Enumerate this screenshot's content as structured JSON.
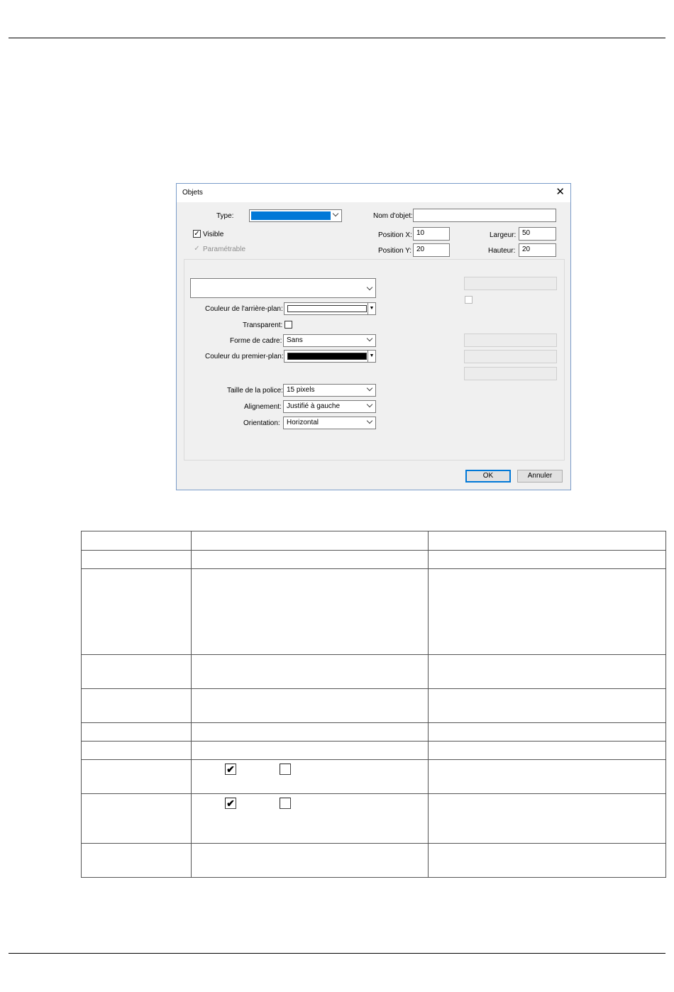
{
  "dialog": {
    "title": "Objets",
    "type_label": "Type:",
    "type_swatch_color": "#0078d7",
    "nom_label": "Nom d'objet:",
    "nom_value": "",
    "visible_label": "Visible",
    "visible_checked": true,
    "parametrable_label": "Paramétrable",
    "parametrable_checked": true,
    "posx_label": "Position X:",
    "posx_value": "10",
    "posy_label": "Position Y:",
    "posy_value": "20",
    "largeur_label": "Largeur:",
    "largeur_value": "50",
    "hauteur_label": "Hauteur:",
    "hauteur_value": "20",
    "couleur_arriere_label": "Couleur de l'arrière-plan:",
    "couleur_arriere_color": "#ffffff",
    "transparent_label": "Transparent:",
    "forme_label": "Forme de cadre:",
    "forme_value": "Sans",
    "couleur_premier_label": "Couleur du premier-plan:",
    "couleur_premier_color": "#000000",
    "taille_label": "Taille de la police:",
    "taille_value": "15 pixels",
    "alignement_label": "Alignement:",
    "alignement_value": "Justifié à gauche",
    "orientation_label": "Orientation:",
    "orientation_value": "Horizontal",
    "ok_label": "OK",
    "annuler_label": "Annuler",
    "accent_color": "#0078d7"
  },
  "table": {
    "check_mark": "✔"
  }
}
